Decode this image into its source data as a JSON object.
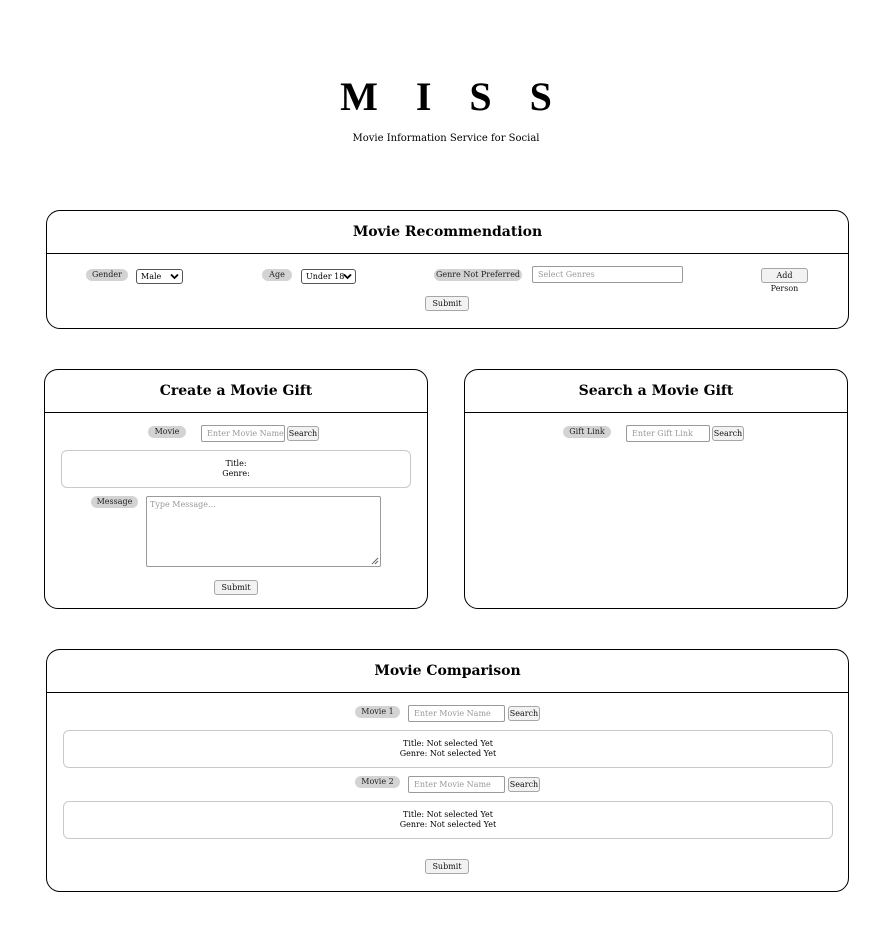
{
  "header": {
    "title": "M I S S",
    "subtitle": "Movie Information Service for Social"
  },
  "recommendation": {
    "title": "Movie Recommendation",
    "gender_label": "Gender",
    "gender_value": "Male",
    "age_label": "Age",
    "age_value": "Under 18",
    "genre_label": "Genre Not Preferred",
    "genre_placeholder": "Select Genres",
    "add_person_label": "Add Person",
    "submit_label": "Submit"
  },
  "gift_create": {
    "title": "Create a Movie Gift",
    "movie_label": "Movie",
    "movie_placeholder": "Enter Movie Name",
    "search_label": "Search",
    "title_line": "Title:",
    "genre_line": "Genre:",
    "message_label": "Message",
    "message_placeholder": "Type Message...",
    "submit_label": "Submit"
  },
  "gift_search": {
    "title": "Search a Movie Gift",
    "link_label": "Gift Link",
    "link_placeholder": "Enter Gift Link",
    "search_label": "Search"
  },
  "comparison": {
    "title": "Movie Comparison",
    "movie1_label": "Movie 1",
    "movie1_placeholder": "Enter Movie Name",
    "movie1_search": "Search",
    "movie1_title": "Title: Not selected Yet",
    "movie1_genre": "Genre: Not selected Yet",
    "movie2_label": "Movie 2",
    "movie2_placeholder": "Enter Movie Name",
    "movie2_search": "Search",
    "movie2_title": "Title: Not selected Yet",
    "movie2_genre": "Genre: Not selected Yet",
    "submit_label": "Submit"
  }
}
